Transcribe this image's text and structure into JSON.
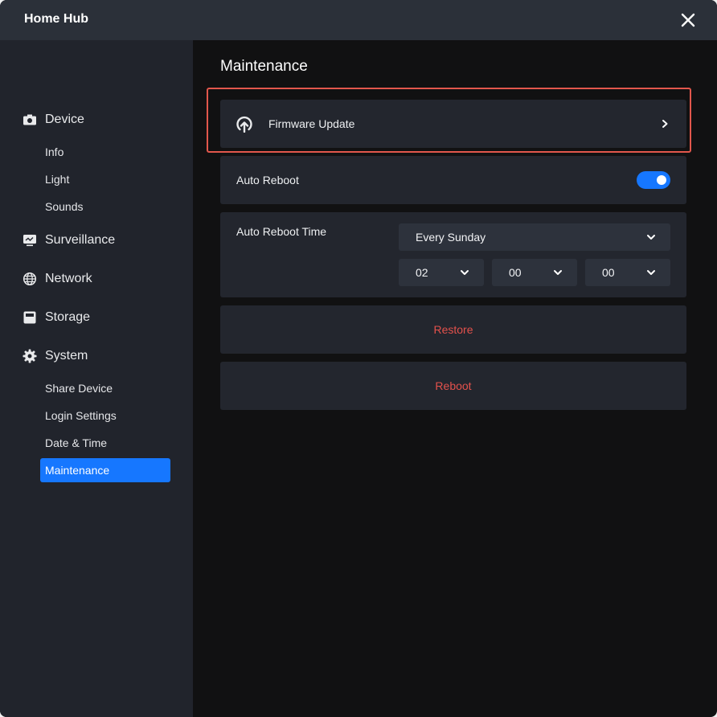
{
  "window": {
    "title": "Home Hub"
  },
  "sidebar": {
    "sections": [
      {
        "label": "Device",
        "icon": "camera-icon",
        "items": [
          "Info",
          "Light",
          "Sounds"
        ]
      },
      {
        "label": "Surveillance",
        "icon": "monitor-icon",
        "items": []
      },
      {
        "label": "Network",
        "icon": "globe-icon",
        "items": []
      },
      {
        "label": "Storage",
        "icon": "storage-icon",
        "items": []
      },
      {
        "label": "System",
        "icon": "gear-icon",
        "items": [
          "Share Device",
          "Login Settings",
          "Date & Time",
          "Maintenance"
        ]
      }
    ],
    "active_item": "Maintenance"
  },
  "main": {
    "title": "Maintenance",
    "firmware": {
      "label": "Firmware Update",
      "icon": "upload-cloud-icon"
    },
    "auto_reboot": {
      "label": "Auto Reboot",
      "enabled": true
    },
    "auto_reboot_time": {
      "label": "Auto Reboot Time",
      "day": "Every Sunday",
      "hour": "02",
      "minute": "00",
      "second": "00"
    },
    "restore_label": "Restore",
    "reboot_label": "Reboot"
  },
  "colors": {
    "accent": "#1677ff",
    "danger": "#e3514c",
    "highlight": "#e2574c"
  }
}
